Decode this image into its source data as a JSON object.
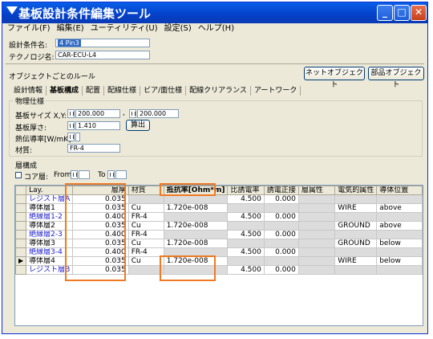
{
  "window": {
    "title": "基板設計条件編集ツール"
  },
  "menu": [
    "ファイル(F)",
    "編集(E)",
    "ユーティリティ(U)",
    "設定(S)",
    "ヘルプ(H)"
  ],
  "condition_name": {
    "label": "設計条件名:",
    "value": "4 Pin3"
  },
  "technology": {
    "label": "テクノロジ名:",
    "value": "CAR-ECU-L4"
  },
  "object_rules": {
    "label": "オブジェクトごとのルール",
    "net_button": "ネットオブジェクト",
    "part_button": "部品オブジェクト"
  },
  "tabs": [
    "設計情報",
    "基板構成",
    "配置",
    "配線仕様",
    "ビア/面仕様",
    "配線クリアランス",
    "アートワーク"
  ],
  "physical": {
    "group_label": "物理仕様",
    "size_label": "基板サイズ X,Y:",
    "size_x": "200.000",
    "comma": ",",
    "size_y": "200.000",
    "thickness_label": "基板厚さ:",
    "thickness_value": "1.410",
    "calc_button": "算出",
    "conductivity_label": "熱伝導率[W/mK]:",
    "conductivity_value": "",
    "material_label": "材質:",
    "material_value": "FR-4"
  },
  "layer_config": {
    "group_label": "層構成",
    "core_label": "コア層:",
    "from_label": "From",
    "to_label": "To"
  },
  "grid": {
    "headers": [
      "Lay.",
      "層厚",
      "材質",
      "抵抗率[Ohm*m]",
      "比誘電率",
      "誘電正接",
      "層属性",
      "電気的属性",
      "導体位置"
    ],
    "rows": [
      {
        "ptr": "",
        "name": "レジスト層A",
        "thickness": "0.035",
        "material": "",
        "resistivity": "",
        "permittivity": "4.500",
        "tangent": "0.000",
        "attr": "",
        "elec": "",
        "pos": ""
      },
      {
        "ptr": "",
        "name": "導体層1",
        "thickness": "0.035",
        "material": "Cu",
        "resistivity": "1.720e-008",
        "permittivity": "",
        "tangent": "",
        "attr": "",
        "elec": "WIRE",
        "pos": "above"
      },
      {
        "ptr": "",
        "name": "絶縁層1-2",
        "thickness": "0.400",
        "material": "FR-4",
        "resistivity": "",
        "permittivity": "4.500",
        "tangent": "0.000",
        "attr": "",
        "elec": "",
        "pos": ""
      },
      {
        "ptr": "",
        "name": "導体層2",
        "thickness": "0.035",
        "material": "Cu",
        "resistivity": "1.720e-008",
        "permittivity": "",
        "tangent": "",
        "attr": "",
        "elec": "GROUND",
        "pos": "above"
      },
      {
        "ptr": "",
        "name": "絶縁層2-3",
        "thickness": "0.400",
        "material": "FR-4",
        "resistivity": "",
        "permittivity": "4.500",
        "tangent": "0.000",
        "attr": "",
        "elec": "",
        "pos": ""
      },
      {
        "ptr": "",
        "name": "導体層3",
        "thickness": "0.035",
        "material": "Cu",
        "resistivity": "1.720e-008",
        "permittivity": "",
        "tangent": "",
        "attr": "",
        "elec": "GROUND",
        "pos": "below"
      },
      {
        "ptr": "",
        "name": "絶縁層3-4",
        "thickness": "0.400",
        "material": "FR-4",
        "resistivity": "",
        "permittivity": "4.500",
        "tangent": "0.000",
        "attr": "",
        "elec": "",
        "pos": ""
      },
      {
        "ptr": "▶",
        "name": "導体層4",
        "thickness": "0.035",
        "material": "Cu",
        "resistivity": "1.720e-008",
        "permittivity": "",
        "tangent": "",
        "attr": "",
        "elec": "WIRE",
        "pos": "below"
      },
      {
        "ptr": "",
        "name": "レジスト層B",
        "thickness": "0.035",
        "material": "",
        "resistivity": "",
        "permittivity": "4.500",
        "tangent": "0.000",
        "attr": "",
        "elec": "",
        "pos": ""
      }
    ]
  },
  "colors": {
    "highlight": "#ef7a22",
    "title_bar": "#0a5fe8",
    "blue_layer_text": "#2222cc"
  }
}
